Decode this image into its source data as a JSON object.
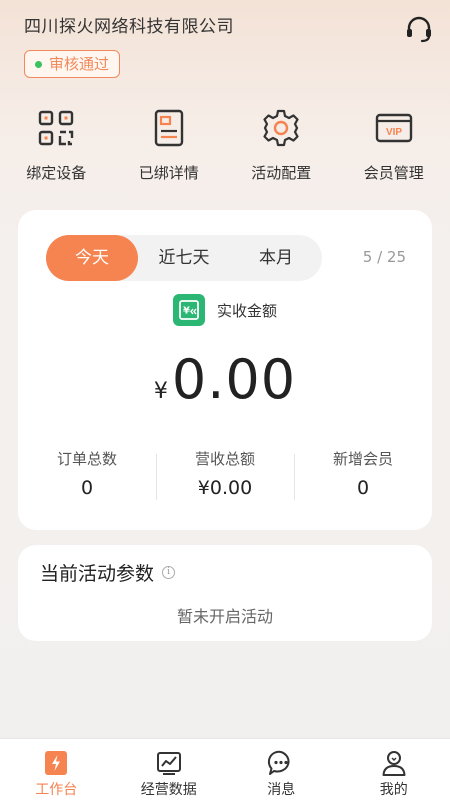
{
  "header": {
    "company_name": "四川探火网络科技有限公司",
    "status_badge": "审核通过"
  },
  "quick_actions": [
    {
      "label": "绑定设备",
      "icon": "qr-code-icon"
    },
    {
      "label": "已绑详情",
      "icon": "document-icon"
    },
    {
      "label": "活动配置",
      "icon": "gear-icon"
    },
    {
      "label": "会员管理",
      "icon": "vip-card-icon"
    }
  ],
  "revenue": {
    "tabs": [
      "今天",
      "近七天",
      "本月"
    ],
    "active_tab": "今天",
    "page_indicator": "5 / 25",
    "label": "实收金额",
    "currency": "¥",
    "amount": "0.00",
    "stats": [
      {
        "label": "订单总数",
        "value": "0"
      },
      {
        "label": "营收总额",
        "value": "¥0.00"
      },
      {
        "label": "新增会员",
        "value": "0"
      }
    ]
  },
  "activity": {
    "title": "当前活动参数",
    "info_glyph": "i",
    "empty_text": "暂未开启活动"
  },
  "tabbar": [
    {
      "label": "工作台",
      "icon": "lightning-icon",
      "active": true
    },
    {
      "label": "经营数据",
      "icon": "chart-icon",
      "active": false
    },
    {
      "label": "消息",
      "icon": "chat-icon",
      "active": false
    },
    {
      "label": "我的",
      "icon": "user-icon",
      "active": false
    }
  ],
  "colors": {
    "accent": "#f58451",
    "status_green": "#39c25e",
    "revenue_icon_green": "#2bb673"
  }
}
